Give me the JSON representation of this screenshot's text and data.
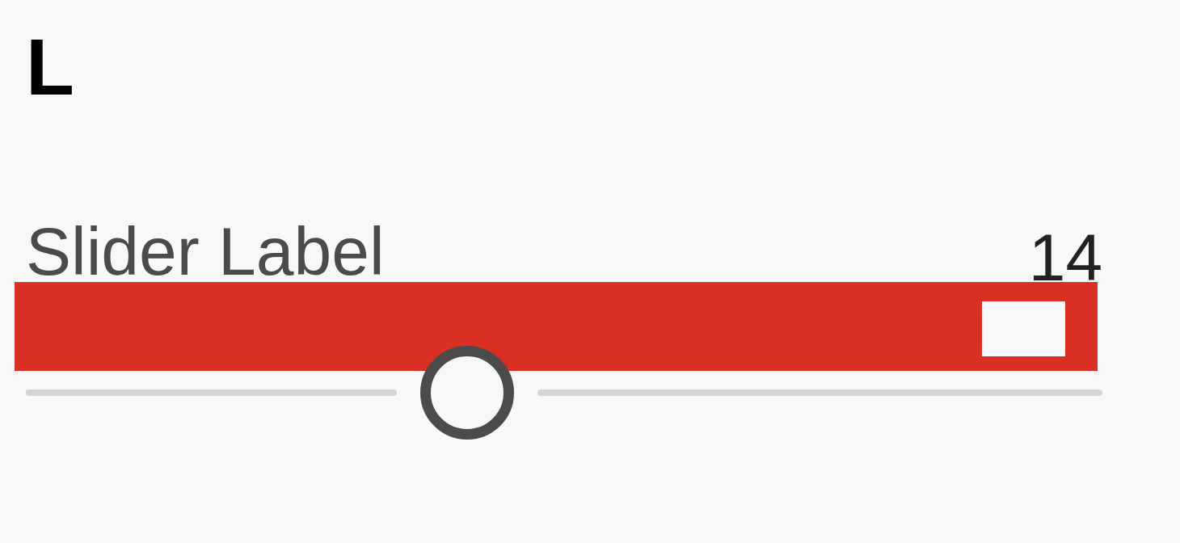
{
  "heading": "L",
  "slider": {
    "label": "Slider Label",
    "value": "14",
    "level": 0.41
  }
}
